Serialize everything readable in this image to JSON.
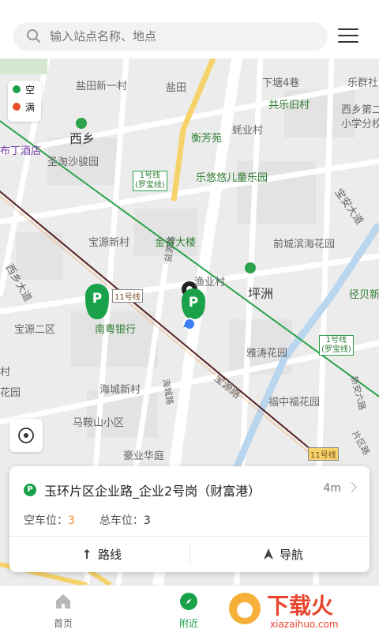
{
  "search": {
    "placeholder": "输入站点名称、地点"
  },
  "legend": [
    {
      "label": "空",
      "color": "#1aa24a"
    },
    {
      "label": "满",
      "color": "#ea4f2c"
    }
  ],
  "map_labels": {
    "yantian_xinyi": "盐田新一村",
    "yantian": "盐田",
    "xiatang4": "下塘4巷",
    "lequn": "乐群社",
    "xixiang": "西乡",
    "gongle": "共乐旧村",
    "xixiang_school_1": "西乡第二",
    "xixiang_school_2": "小学分校",
    "hengfang": "衡芳苑",
    "huangye": "蚝业村",
    "hotel": "布丁酒店",
    "shengtao": "圣淘沙骏园",
    "line1_a_1": "1号线",
    "line1_a_2": "(罗宝线)",
    "leyouyou": "乐悠悠儿童乐园",
    "baoan_ave": "宝安大道",
    "baoyuan": "宝源新村",
    "jingu": "金谷大楼",
    "qiancheng": "前城滨海花园",
    "xixiang_ave": "西乡大道",
    "yiyuan_rd": "益源路",
    "yiye": "渔业村",
    "pingzhou": "坪洲",
    "jingbei": "径贝新",
    "line11_a": "11号线",
    "nanyue_bank": "南粤银行",
    "baoyuan2": "宝源二区",
    "yatao": "雅涛花园",
    "line1_b_1": "1号线",
    "line1_b_2": "(罗宝线)",
    "baoyuan_rd": "宝源路",
    "haicheng_rd": "海城路",
    "haicheng": "海城新村",
    "village_left": "村",
    "garden_left": "花园",
    "fuzhong": "福中福花园",
    "xinan_rd": "新安六路",
    "majin": "马鞍山小区",
    "pian_rd": "片区路",
    "haomeng": "豪业华庭",
    "line11_b": "11号线"
  },
  "card": {
    "parking_icon": "P",
    "name": "玉环片区企业路_企业2号岗（财富港）",
    "distance": "4m",
    "empty_label": "空车位：",
    "empty_value": "3",
    "total_label": "总车位：",
    "total_value": "3",
    "route_label": "路线",
    "navigate_label": "导航"
  },
  "tabs": [
    {
      "label": "首页",
      "active": false
    },
    {
      "label": "附近",
      "active": true
    }
  ],
  "colors": {
    "accent": "#1aa24a",
    "orange": "#f08a2c",
    "metro_green": "#2ca24a",
    "metro_brown": "#5a2020"
  }
}
